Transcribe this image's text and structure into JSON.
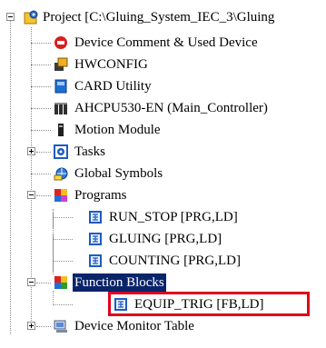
{
  "tree": {
    "root": {
      "label": "Project [C:\\Gluing_System_IEC_3\\Gluing",
      "icon": "project-gear-icon",
      "expanded": true
    },
    "items": [
      {
        "label": "Device Comment & Used Device",
        "icon": "device-comment-icon"
      },
      {
        "label": "HWCONFIG",
        "icon": "hwconfig-icon"
      },
      {
        "label": "CARD Utility",
        "icon": "card-utility-icon"
      },
      {
        "label": "AHCPU530-EN  (Main_Controller)",
        "icon": "cpu-module-icon"
      },
      {
        "label": "Motion Module",
        "icon": "motion-module-icon"
      },
      {
        "label": "Tasks",
        "icon": "tasks-icon",
        "expanded": false
      },
      {
        "label": "Global Symbols",
        "icon": "global-symbols-icon"
      },
      {
        "label": "Programs",
        "icon": "programs-folder-icon",
        "expanded": true
      },
      {
        "label": "RUN_STOP [PRG,LD]",
        "icon": "pou-icon"
      },
      {
        "label": "GLUING [PRG,LD]",
        "icon": "pou-icon"
      },
      {
        "label": "COUNTING [PRG,LD]",
        "icon": "pou-icon"
      },
      {
        "label": "Function Blocks",
        "icon": "function-blocks-folder-icon",
        "expanded": true,
        "selected": true
      },
      {
        "label": "EQUIP_TRIG [FB,LD]",
        "icon": "pou-icon",
        "highlighted": true
      },
      {
        "label": "Device Monitor Table",
        "icon": "device-monitor-icon",
        "expanded": false
      }
    ]
  },
  "colors": {
    "selection": "#0a246a",
    "highlight_border": "#e0001b"
  }
}
